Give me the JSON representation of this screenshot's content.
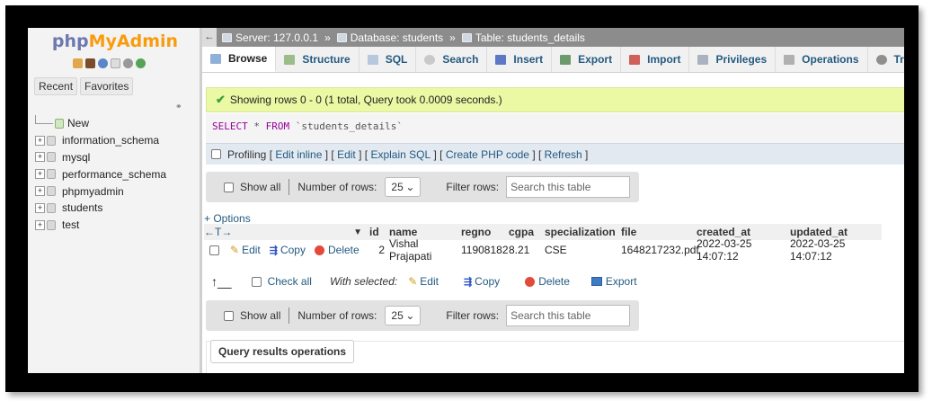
{
  "sidebar": {
    "logo_php": "php",
    "logo_my": "MyAdmin",
    "tab_recent": "Recent",
    "tab_favorites": "Favorites",
    "new_label": "New",
    "databases": [
      "information_schema",
      "mysql",
      "performance_schema",
      "phpmyadmin",
      "students",
      "test"
    ]
  },
  "breadcrumb": {
    "server": "Server: 127.0.0.1",
    "database": "Database: students",
    "table": "Table: students_details",
    "separator": "»"
  },
  "topmenu": [
    "Browse",
    "Structure",
    "SQL",
    "Search",
    "Insert",
    "Export",
    "Import",
    "Privileges",
    "Operations",
    "Tracking"
  ],
  "message": "Showing rows 0 - 0 (1 total, Query took 0.0009 seconds.)",
  "sql": {
    "kw_select": "SELECT",
    "star": "*",
    "kw_from": "FROM",
    "table": "`students_details`"
  },
  "profiling": {
    "label": "Profiling",
    "edit_inline": "Edit inline",
    "edit": "Edit",
    "explain": "Explain SQL",
    "create_php": "Create PHP code",
    "refresh": "Refresh"
  },
  "navigation": {
    "show_all": "Show all",
    "rows_label": "Number of rows:",
    "rows_value": "25",
    "filter_label": "Filter rows:",
    "filter_placeholder": "Search this table"
  },
  "options_link": "+ Options",
  "grid": {
    "columns": [
      "id",
      "name",
      "regno",
      "cgpa",
      "specialization",
      "file",
      "created_at",
      "updated_at"
    ],
    "row": {
      "id": "2",
      "name": "Vishal Prajapati",
      "regno": "11908182",
      "cgpa": "8.21",
      "specialization": "CSE",
      "file": "1648217232.pdf",
      "created_at": "2022-03-25 14:07:12",
      "updated_at": "2022-03-25 14:07:12"
    },
    "row_actions": {
      "edit": "Edit",
      "copy": "Copy",
      "delete": "Delete"
    }
  },
  "bulk": {
    "check_all": "Check all",
    "with_selected": "With selected:",
    "edit": "Edit",
    "copy": "Copy",
    "delete": "Delete",
    "export": "Export"
  },
  "query_results_ops": "Query results operations",
  "colors": {
    "link": "#235a81",
    "success_bg": "#ebf8a4",
    "logo_php": "#6c78af",
    "logo_my": "#f89c0e"
  }
}
